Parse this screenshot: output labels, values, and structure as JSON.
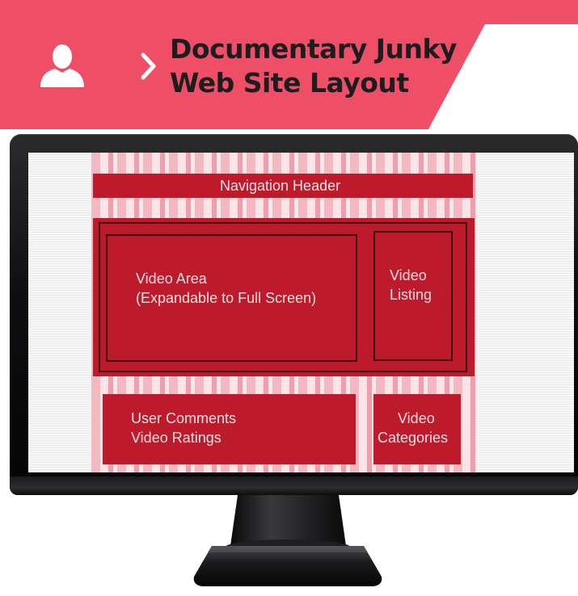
{
  "banner": {
    "icon": "user-icon",
    "chevron": "chevron-right-icon",
    "title_line1": "Documentary Junky",
    "title_line2": "Web Site Layout",
    "color": "#ef4f66"
  },
  "layout": {
    "nav_header": "Navigation Header",
    "video_area_line1": "Video Area",
    "video_area_line2": "(Expandable to Full Screen)",
    "video_listing_line1": "Video",
    "video_listing_line2": "Listing",
    "comments_line1": "User Comments",
    "comments_line2": "Video Ratings",
    "categories_line1": "Video",
    "categories_line2": "Categories",
    "block_color": "#bd1b2c"
  }
}
